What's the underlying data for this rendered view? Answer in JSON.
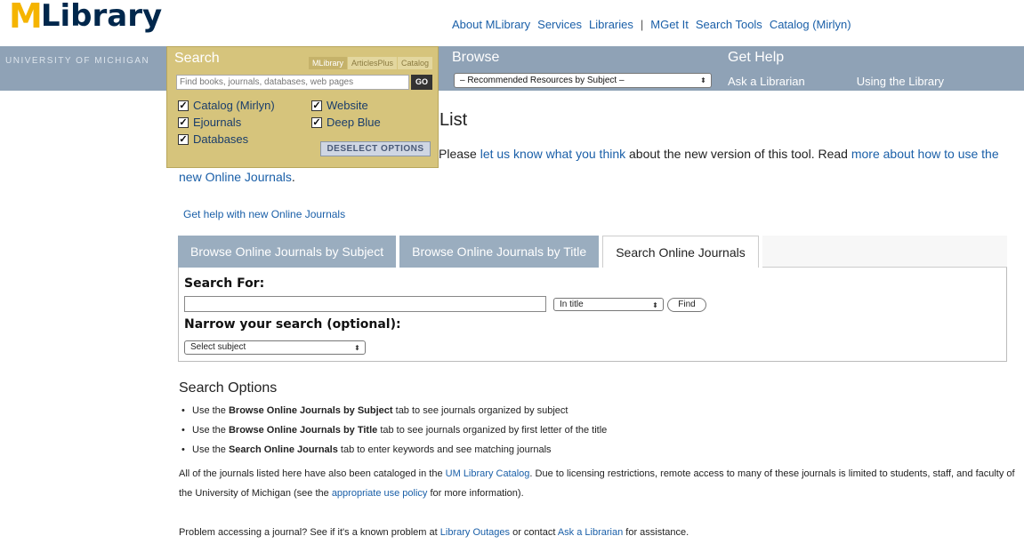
{
  "logo": {
    "m": "M",
    "text": "Library"
  },
  "topnav": [
    "About MLibrary",
    "Services",
    "Libraries",
    "|",
    "MGet It",
    "Search Tools",
    "Catalog (Mirlyn)"
  ],
  "university": "UNIVERSITY OF MICHIGAN",
  "search_panel": {
    "title": "Search",
    "tabs": [
      "MLibrary",
      "ArticlesPlus",
      "Catalog"
    ],
    "placeholder": "Find books, journals, databases, web pages",
    "go": "GO",
    "checks": [
      "Catalog (Mirlyn)",
      "Website",
      "Ejournals",
      "Deep Blue",
      "Databases"
    ],
    "check_mark": "✓",
    "deselect": "DESELECT OPTIONS"
  },
  "browse": {
    "title": "Browse",
    "select": "– Recommended Resources by Subject –",
    "arrow": "⬍"
  },
  "gethelp": {
    "title": "Get Help",
    "ask": "Ask a Librarian",
    "using": "Using the Library"
  },
  "main": {
    "title": "List",
    "intro": {
      "p1": "Please ",
      "link1": "let us know what you think",
      "p2": " about the new version of this tool. Read ",
      "link2": "more about how to use the new Online Journals",
      "p3": "."
    },
    "help_link": "Get help with new Online Journals",
    "tabs": [
      "Browse Online Journals by Subject",
      "Browse Online Journals by Title",
      "Search Online Journals"
    ],
    "search_for": "Search For:",
    "in_title": "In title",
    "find": "Find",
    "narrow": "Narrow your search (optional):",
    "select_subject": "Select subject"
  },
  "search_options": {
    "title": "Search Options",
    "items": [
      {
        "pre": "Use the ",
        "bold": "Browse Online Journals by Subject",
        "post": " tab to see journals organized by subject"
      },
      {
        "pre": "Use the ",
        "bold": "Browse Online Journals by Title",
        "post": " tab to see journals organized by first letter of the title"
      },
      {
        "pre": "Use the ",
        "bold": "Search Online Journals",
        "post": " tab to enter keywords and see matching journals"
      }
    ]
  },
  "catalog_para": {
    "p1": "All of the journals listed here have also been cataloged in the ",
    "link1": "UM Library Catalog",
    "p2": ". Due to licensing restrictions, remote access to many of these journals is limited to students, staff, and faculty of the University of Michigan (see the ",
    "link2": "appropriate use policy",
    "p3": " for more information)."
  },
  "problem_para": {
    "p1": "Problem accessing a journal? See if it's a known problem at ",
    "link1": "Library Outages",
    "p2": " or contact ",
    "link2": "Ask a Librarian",
    "p3": " for assistance."
  }
}
